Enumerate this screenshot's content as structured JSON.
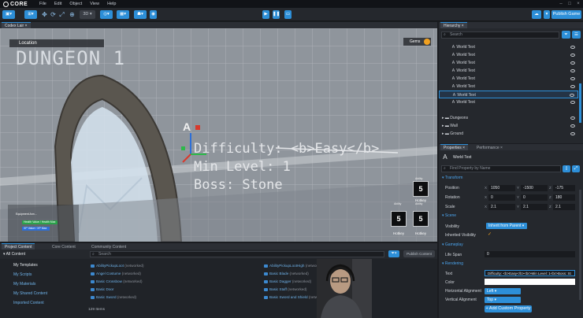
{
  "menu": {
    "brand": "CORE",
    "items": [
      "File",
      "Edit",
      "Object",
      "View",
      "Help"
    ]
  },
  "toolbar": {
    "mode_3d": "3D",
    "publish": "Publish Game"
  },
  "viewport_tab": "Codex Lair",
  "viewport": {
    "location_label": "Location",
    "dungeon_title": "DUNGEON 1",
    "gems_label": "Gems",
    "world_text_lines": [
      "Difficulty: <b>Easy</b>",
      "Min Level: 1",
      "Boss: Stone"
    ],
    "abilities": [
      {
        "caption": "Ability",
        "value": "5",
        "hotkey": "Hotkey"
      },
      {
        "caption": "Ability",
        "value": "5",
        "hotkey": "Hotkey"
      },
      {
        "caption": "Ability",
        "value": "5",
        "hotkey": "Hotkey"
      }
    ],
    "equipment_label": "Equipment Ann...",
    "bar_labels": [
      "Health Value / Health Max",
      "XP Value / XP Max"
    ]
  },
  "project_tabs": [
    "Project Content",
    "Core Content",
    "Community Content"
  ],
  "project": {
    "all_content": "All Content",
    "search_placeholder": "Search",
    "publish_button": "Publish Content",
    "nav": [
      "My Templates",
      "My Scripts",
      "My Materials",
      "My Shared Content",
      "Imported Content"
    ],
    "assets_col1": [
      {
        "name": "AbilityPickupLoot",
        "tag": "(networked)"
      },
      {
        "name": "Angel Costume",
        "tag": "(networked)"
      },
      {
        "name": "Basic Crossbow",
        "tag": "(networked)"
      },
      {
        "name": "Basic Door",
        "tag": ""
      },
      {
        "name": "Basic Sword",
        "tag": "(networked)"
      }
    ],
    "assets_col2": [
      {
        "name": "AbilityPickupLootHigh",
        "tag": "(networked)"
      },
      {
        "name": "Basic Blade",
        "tag": "(networked)"
      },
      {
        "name": "Basic Dagger",
        "tag": "(networked)"
      },
      {
        "name": "Basic Staff",
        "tag": "(networked)"
      },
      {
        "name": "Basic Sword and Shield",
        "tag": "(networked)"
      }
    ],
    "item_count": "129 Items"
  },
  "hierarchy": {
    "title": "Hierarchy",
    "search_placeholder": "Search",
    "rows": [
      "World Text",
      "World Text",
      "World Text",
      "World Text",
      "World Text",
      "World Text",
      "World Text",
      "World Text",
      "Dungeons",
      "Wall",
      "Ground"
    ],
    "selected_index": 6
  },
  "properties": {
    "tabs": [
      "Properties",
      "Performance"
    ],
    "object_name": "World Text",
    "search_placeholder": "Find Property by Name",
    "transform_label": "Transform",
    "position": {
      "label": "Position",
      "x": "1050",
      "y": "-1500",
      "z": "-175"
    },
    "rotation": {
      "label": "Rotation",
      "x": "0",
      "y": "0",
      "z": "180"
    },
    "scale": {
      "label": "Scale",
      "x": "2.1",
      "y": "2.1",
      "z": "2.1"
    },
    "scene_label": "Scene",
    "visibility": {
      "label": "Visibility",
      "value": "Inherit from Parent"
    },
    "inherited_visibility": {
      "label": "Inherited Visibility"
    },
    "gameplay_label": "Gameplay",
    "life_span": {
      "label": "Life Span",
      "value": "0"
    },
    "rendering_label": "Rendering",
    "text": {
      "label": "Text",
      "value": "Difficulty: <b>Easy</b><br>Min Level: 1<br>Boss: St"
    },
    "color": {
      "label": "Color"
    },
    "halign": {
      "label": "Horizontal Alignment",
      "value": "Left"
    },
    "valign": {
      "label": "Vertical Alignment",
      "value": "Top"
    },
    "add_custom": "Add Custom Property"
  },
  "colors": {
    "accent": "#2d8fd8",
    "panel": "#25282d",
    "link": "#6fb3ea"
  }
}
